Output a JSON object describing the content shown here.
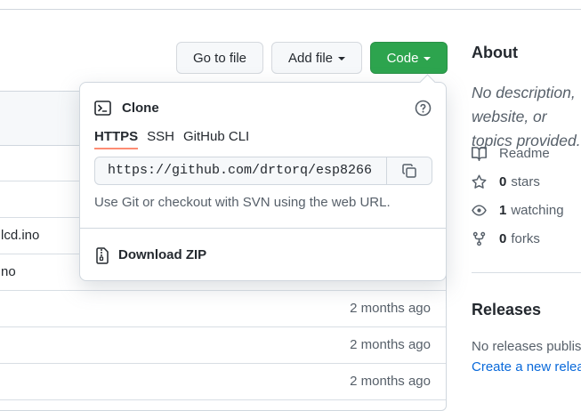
{
  "toolbar": {
    "goto_label": "Go to file",
    "add_file_label": "Add file",
    "code_label": "Code"
  },
  "files": [
    {
      "name": "",
      "time": ""
    },
    {
      "name": "",
      "time": ""
    },
    {
      "name": "lcd.ino",
      "time": ""
    },
    {
      "name": "no",
      "time": ""
    },
    {
      "name": "",
      "time": "2 months ago"
    },
    {
      "name": "",
      "time": "2 months ago"
    },
    {
      "name": "",
      "time": "2 months ago"
    }
  ],
  "clone": {
    "title": "Clone",
    "tabs": [
      "HTTPS",
      "SSH",
      "GitHub CLI"
    ],
    "active_tab": "HTTPS",
    "url": "https://github.com/drtorq/esp8266",
    "hint": "Use Git or checkout with SVN using the web URL.",
    "download_label": "Download ZIP"
  },
  "about": {
    "title": "About",
    "description": "No description, website, or topics provided.",
    "readme": "Readme",
    "stars_count": "0",
    "stars_label": "stars",
    "watching_count": "1",
    "watching_label": "watching",
    "forks_count": "0",
    "forks_label": "forks"
  },
  "releases": {
    "title": "Releases",
    "none_text": "No releases published",
    "create_link": "Create a new release"
  },
  "colors": {
    "code_button": "#2da44e",
    "link": "#0969da",
    "tab_underline": "#fd8c73"
  }
}
